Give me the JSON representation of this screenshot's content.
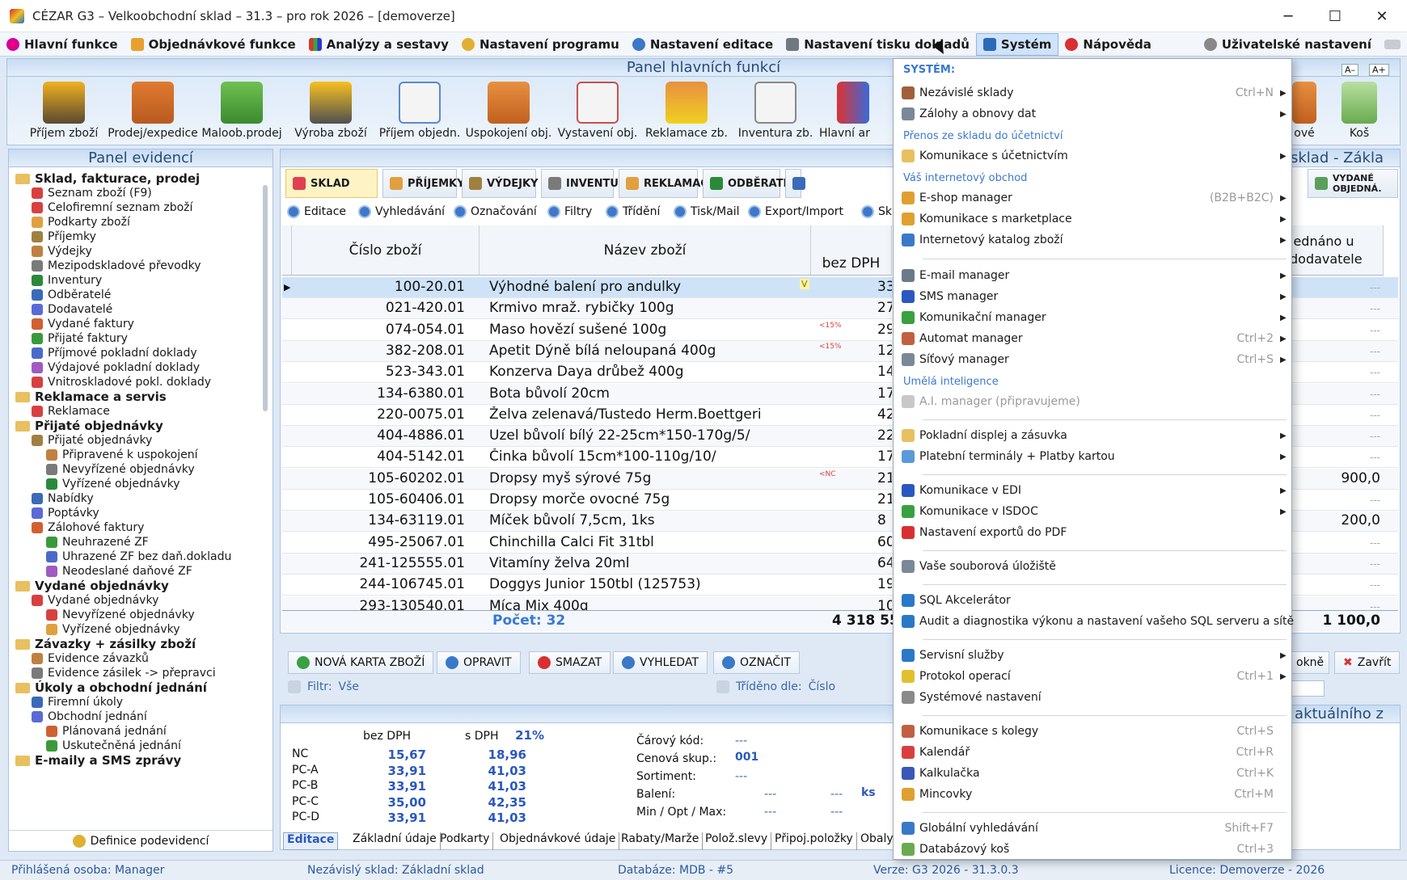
{
  "window": {
    "title": "CÉZAR G3 – Velkoobchodní sklad – 31.3 – pro rok 2026 – [demoverze]"
  },
  "menubar": {
    "items": [
      "Hlavní funkce",
      "Objednávkové funkce",
      "Analýzy a sestavy",
      "Nastavení programu",
      "Nastavení editace",
      "Nastavení tisku dokladů",
      "Systém",
      "Nápověda"
    ],
    "user_settings": "Uživatelské nastavení"
  },
  "funcpanel": {
    "title": "Panel hlavních funkcí",
    "buttons": [
      "Příjem zboží",
      "Prodej/expedice",
      "Maloob.prodej",
      "Výroba zboží",
      "Příjem objedn.",
      "Uspokojení obj.",
      "Vystavení obj.",
      "Reklamace zb.",
      "Inventura zb.",
      "Hlavní ar"
    ],
    "right_buttons": [
      "ové",
      "Koš"
    ],
    "font_small": "A–",
    "font_big": "A+"
  },
  "leftpanel": {
    "title": "Panel evidencí",
    "footer": "Definice podevidencí",
    "tree": [
      {
        "label": "Sklad, fakturace, prodej",
        "level": 0,
        "group": true
      },
      {
        "label": "Seznam zboží (F9)",
        "level": 1
      },
      {
        "label": "Celofiremní seznam zboží",
        "level": 1
      },
      {
        "label": "Podkarty zboží",
        "level": 1
      },
      {
        "label": "Příjemky",
        "level": 1
      },
      {
        "label": "Výdejky",
        "level": 1
      },
      {
        "label": "Mezipodskladové převodky",
        "level": 1
      },
      {
        "label": "Inventury",
        "level": 1
      },
      {
        "label": "Odběratelé",
        "level": 1
      },
      {
        "label": "Dodavatelé",
        "level": 1
      },
      {
        "label": "Vydané faktury",
        "level": 1
      },
      {
        "label": "Přijaté faktury",
        "level": 1
      },
      {
        "label": "Příjmové pokladní doklady",
        "level": 1
      },
      {
        "label": "Výdajové pokladní doklady",
        "level": 1
      },
      {
        "label": "Vnitroskladové pokl. doklady",
        "level": 1
      },
      {
        "label": "Reklamace a servis",
        "level": 0,
        "group": true
      },
      {
        "label": "Reklamace",
        "level": 1
      },
      {
        "label": "Přijaté objednávky",
        "level": 0,
        "group": true
      },
      {
        "label": "Přijaté objednávky",
        "level": 1
      },
      {
        "label": "Připravené k uspokojení",
        "level": 2
      },
      {
        "label": "Nevyřízené objednávky",
        "level": 2
      },
      {
        "label": "Vyřízené objednávky",
        "level": 2
      },
      {
        "label": "Nabídky",
        "level": 1
      },
      {
        "label": "Poptávky",
        "level": 1
      },
      {
        "label": "Zálohové faktury",
        "level": 1
      },
      {
        "label": "Neuhrazené ZF",
        "level": 2
      },
      {
        "label": "Uhrazené ZF bez daň.dokladu",
        "level": 2
      },
      {
        "label": "Neodeslané daňové ZF",
        "level": 2
      },
      {
        "label": "Vydané objednávky",
        "level": 0,
        "group": true
      },
      {
        "label": "Vydané objednávky",
        "level": 1
      },
      {
        "label": "Nevyřízené objednávky",
        "level": 2
      },
      {
        "label": "Vyřízené objednávky",
        "level": 2
      },
      {
        "label": "Závazky + zásilky zboží",
        "level": 0,
        "group": true
      },
      {
        "label": "Evidence závazků",
        "level": 1
      },
      {
        "label": "Evidence zásilek -> přepravci",
        "level": 1
      },
      {
        "label": "Úkoly a obchodní jednání",
        "level": 0,
        "group": true
      },
      {
        "label": "Firemní úkoly",
        "level": 1
      },
      {
        "label": "Obchodní jednání",
        "level": 1
      },
      {
        "label": "Plánovaná jednání",
        "level": 2
      },
      {
        "label": "Uskutečněná jednání",
        "level": 2
      },
      {
        "label": "E-maily a SMS zprávy",
        "level": 0,
        "group": true
      }
    ]
  },
  "main": {
    "title": "Nezávislý sklad - Zákla",
    "tabs": [
      "SKLAD",
      "PŘÍJEMKY",
      "VÝDEJKY",
      "INVENTUR.",
      "REKLAMAC.",
      "ODBĚRATE.",
      "D"
    ],
    "tab_right": "VYDANÉ OBJEDNÁ.",
    "toolbar": [
      "Editace",
      "Vyhledávání",
      "Označování",
      "Filtry",
      "Třídění",
      "Tisk/Mail",
      "Export/Import",
      "Sk"
    ],
    "columns": {
      "code": "Číslo zboží",
      "name": "Název zboží",
      "price": "bez DPH",
      "right": "jednáno u dodavatele"
    },
    "rows": [
      {
        "code": "100-20.01",
        "name": "Výhodné balení pro andulky",
        "price": "33",
        "right": "---",
        "flag": "V"
      },
      {
        "code": "021-420.01",
        "name": "Krmivo mraž. rybičky 100g",
        "price": "27",
        "right": "---"
      },
      {
        "code": "074-054.01",
        "name": "Maso hovězí sušené 100g",
        "price": "29",
        "right": "---",
        "flag": "<15%"
      },
      {
        "code": "382-208.01",
        "name": "Apetit Dýně bílá neloupaná 400g",
        "price": "12",
        "right": "---",
        "flag": "<15%"
      },
      {
        "code": "523-343.01",
        "name": "Konzerva Daya drůbež 400g",
        "price": "14",
        "right": "---"
      },
      {
        "code": "134-6380.01",
        "name": "Bota bůvolí 20cm",
        "price": "17",
        "right": "---"
      },
      {
        "code": "220-0075.01",
        "name": "Želva zelenavá/Tustedo Herm.Boettgeri",
        "price": "42",
        "right": "---"
      },
      {
        "code": "404-4886.01",
        "name": "Uzel bůvolí bílý 22-25cm*150-170g/5/",
        "price": "22",
        "right": "---"
      },
      {
        "code": "404-5142.01",
        "name": "Činka bůvolí 15cm*100-110g/10/",
        "price": "17",
        "right": "---"
      },
      {
        "code": "105-60202.01",
        "name": "Dropsy myš sýrové 75g",
        "price": "21",
        "right": "900,0",
        "flag": "<NC"
      },
      {
        "code": "105-60406.01",
        "name": "Dropsy morče ovocné 75g",
        "price": "21",
        "right": "---"
      },
      {
        "code": "134-63119.01",
        "name": "Míček bůvolí 7,5cm, 1ks",
        "price": "8",
        "right": "200,0"
      },
      {
        "code": "495-25067.01",
        "name": "Chinchilla Calci Fit 31tbl",
        "price": "60",
        "right": "---"
      },
      {
        "code": "241-125555.01",
        "name": "Vitamíny želva 20ml",
        "price": "64",
        "right": "---"
      },
      {
        "code": "244-106745.01",
        "name": "Doggys Junior 150tbl (125753)",
        "price": "197",
        "right": "---"
      },
      {
        "code": "293-130540.01",
        "name": "Míca Mix 400g",
        "price": "10",
        "right": "---"
      }
    ],
    "total_label": "Počet: 32",
    "total_price": "4 318 55",
    "total_right": "1 100,0",
    "buttons": [
      "NOVÁ KARTA ZBOŽÍ",
      "OPRAVIT",
      "SMAZAT",
      "VYHLEDAT",
      "OZNAČIT"
    ],
    "buttons_right": [
      "okně",
      "Zavřít"
    ],
    "filter_label": "Filtr:",
    "filter_value": "Vše",
    "sort_label": "Tříděno dle:",
    "sort_value": "Číslo"
  },
  "detail": {
    "title": "Údaje aktuálního z",
    "head": {
      "bez": "bez DPH",
      "s": "s DPH",
      "vat": "21%"
    },
    "prices": [
      {
        "l": "NC",
        "a": "15,67",
        "b": "18,96"
      },
      {
        "l": "PC-A",
        "a": "33,91",
        "b": "41,03"
      },
      {
        "l": "PC-B",
        "a": "33,91",
        "b": "41,03"
      },
      {
        "l": "PC-C",
        "a": "35,00",
        "b": "42,35"
      },
      {
        "l": "PC-D",
        "a": "33,91",
        "b": "41,03"
      }
    ],
    "fields": {
      "barcode_l": "Čárový kód:",
      "barcode_v": "---",
      "price_grp_l": "Cenová skup.:",
      "price_grp_v": "001",
      "sortiment_l": "Sortiment:",
      "sortiment_v": "---",
      "pack_l": "Balení:",
      "pack_v1": "---",
      "pack_v2": "---",
      "pack_unit": "ks",
      "minmax_l": "Min / Opt / Max:",
      "minmax_v1": "---",
      "minmax_v2": "---"
    },
    "tabs": [
      "Editace",
      "Základní údaje",
      "Podkarty",
      "Objednávkové údaje",
      "Rabaty/Marže",
      "Polož.slevy",
      "Připoj.položky",
      "Obaly"
    ]
  },
  "status": {
    "user": "Přihlášená osoba:  Manager",
    "store": "Nezávislý sklad:  Základní sklad",
    "db": "Databáze:  MDB - #5",
    "ver": "Verze:  G3 2026 - 31.3.0.3",
    "lic": "Licence:  Demoverze - 2026"
  },
  "dropdown": {
    "title": "SYSTÉM:",
    "sec_transfer": "Přenos ze skladu do účetnictví",
    "sec_shop": "Váš internetový obchod",
    "sec_ai": "Umělá inteligence",
    "items": {
      "nez": {
        "label": "Nezávislé sklady",
        "sc": "Ctrl+N"
      },
      "zal": {
        "label": "Zálohy a obnovy dat",
        "sc": ""
      },
      "uct": {
        "label": "Komunikace s účetnictvím",
        "sc": ""
      },
      "esh": {
        "label": "E-shop manager",
        "sc": "(B2B+B2C)"
      },
      "mkp": {
        "label": "Komunikace s marketplace",
        "sc": ""
      },
      "kat": {
        "label": "Internetový katalog zboží",
        "sc": ""
      },
      "eml": {
        "label": "E-mail manager",
        "sc": ""
      },
      "sms": {
        "label": "SMS manager",
        "sc": ""
      },
      "kom": {
        "label": "Komunikační manager",
        "sc": ""
      },
      "aut": {
        "label": "Automat manager",
        "sc": "Ctrl+2"
      },
      "sit": {
        "label": "Síťový manager",
        "sc": "Ctrl+S"
      },
      "ai": {
        "label": "A.I. manager (připravujeme)",
        "sc": ""
      },
      "pok": {
        "label": "Pokladní displej a zásuvka",
        "sc": ""
      },
      "pla": {
        "label": "Platební terminály + Platby kartou",
        "sc": ""
      },
      "edi": {
        "label": "Komunikace v EDI",
        "sc": ""
      },
      "isd": {
        "label": "Komunikace v ISDOC",
        "sc": ""
      },
      "pdf": {
        "label": "Nastavení exportů do PDF",
        "sc": ""
      },
      "sou": {
        "label": "Vaše souborová úložiště",
        "sc": ""
      },
      "sql": {
        "label": "SQL Akcelerátor",
        "sc": ""
      },
      "aud": {
        "label": "Audit a diagnostika výkonu a nastavení vašeho SQL serveru a sítě",
        "sc": ""
      },
      "ser": {
        "label": "Servisní služby",
        "sc": ""
      },
      "pro": {
        "label": "Protokol operací",
        "sc": "Ctrl+1"
      },
      "sys": {
        "label": "Systémové nastavení",
        "sc": ""
      },
      "kol": {
        "label": "Komunikace s kolegy",
        "sc": "Ctrl+S"
      },
      "kal": {
        "label": "Kalendář",
        "sc": "Ctrl+R"
      },
      "kak": {
        "label": "Kalkulačka",
        "sc": "Ctrl+K"
      },
      "min": {
        "label": "Mincovky",
        "sc": "Ctrl+M"
      },
      "glo": {
        "label": "Globální vyhledávání",
        "sc": "Shift+F7"
      },
      "dbk": {
        "label": "Databázový koš",
        "sc": "Ctrl+3"
      }
    }
  }
}
